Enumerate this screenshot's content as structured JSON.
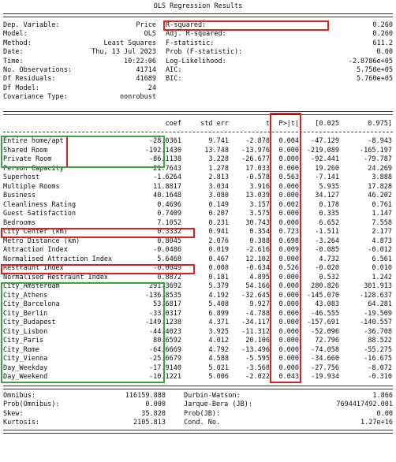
{
  "title": "OLS Regression Results",
  "header_left": [
    {
      "label": "Dep. Variable:",
      "value": "Price"
    },
    {
      "label": "Model:",
      "value": "OLS"
    },
    {
      "label": "Method:",
      "value": "Least Squares"
    },
    {
      "label": "Date:",
      "value": "Thu, 13 Jul 2023"
    },
    {
      "label": "Time:",
      "value": "10:22:06"
    },
    {
      "label": "No. Observations:",
      "value": "41714"
    },
    {
      "label": "Df Residuals:",
      "value": "41689"
    },
    {
      "label": "Df Model:",
      "value": "24"
    },
    {
      "label": "Covariance Type:",
      "value": "nonrobust"
    }
  ],
  "header_right": [
    {
      "label": "R-squared:",
      "value": "0.260"
    },
    {
      "label": "Adj. R-squared:",
      "value": "0.260"
    },
    {
      "label": "F-statistic:",
      "value": "611.2"
    },
    {
      "label": "Prob (F-statistic):",
      "value": "0.00"
    },
    {
      "label": "Log-Likelihood:",
      "value": "-2.8786e+05"
    },
    {
      "label": "AIC:",
      "value": "5.758e+05"
    },
    {
      "label": "BIC:",
      "value": "5.760e+05"
    }
  ],
  "columns": [
    "coef",
    "std err",
    "t",
    "P>|t|",
    "[0.025",
    "0.975]"
  ],
  "rows": [
    {
      "name": "Entire home/apt",
      "coef": "-28.0361",
      "stderr": "9.741",
      "t": "-2.878",
      "p": "0.004",
      "lo": "-47.129",
      "hi": "-8.943"
    },
    {
      "name": "Shared Room",
      "coef": "-192.1430",
      "stderr": "13.748",
      "t": "-13.976",
      "p": "0.000",
      "lo": "-219.089",
      "hi": "-165.197"
    },
    {
      "name": "Private Room",
      "coef": "-86.1138",
      "stderr": "3.228",
      "t": "-26.677",
      "p": "0.000",
      "lo": "-92.441",
      "hi": "-79.787"
    },
    {
      "name": "Person Capacity",
      "coef": "21.7643",
      "stderr": "1.278",
      "t": "17.033",
      "p": "0.000",
      "lo": "19.260",
      "hi": "24.269"
    },
    {
      "name": "Superhost",
      "coef": "-1.6264",
      "stderr": "2.813",
      "t": "-0.578",
      "p": "0.563",
      "lo": "-7.141",
      "hi": "3.888"
    },
    {
      "name": "Multiple Rooms",
      "coef": "11.8817",
      "stderr": "3.034",
      "t": "3.916",
      "p": "0.000",
      "lo": "5.935",
      "hi": "17.828"
    },
    {
      "name": "Business",
      "coef": "40.1648",
      "stderr": "3.080",
      "t": "13.039",
      "p": "0.000",
      "lo": "34.127",
      "hi": "46.202"
    },
    {
      "name": "Cleanliness Rating",
      "coef": "0.4696",
      "stderr": "0.149",
      "t": "3.157",
      "p": "0.002",
      "lo": "0.178",
      "hi": "0.761"
    },
    {
      "name": "Guest Satisfaction",
      "coef": "0.7409",
      "stderr": "0.207",
      "t": "3.575",
      "p": "0.000",
      "lo": "0.335",
      "hi": "1.147"
    },
    {
      "name": "Bedrooms",
      "coef": "7.1052",
      "stderr": "0.231",
      "t": "30.743",
      "p": "0.000",
      "lo": "6.652",
      "hi": "7.558"
    },
    {
      "name": "City Center (km)",
      "coef": "0.3332",
      "stderr": "0.941",
      "t": "0.354",
      "p": "0.723",
      "lo": "-1.511",
      "hi": "2.177"
    },
    {
      "name": "Metro Distance (km)",
      "coef": "0.8045",
      "stderr": "2.076",
      "t": "0.388",
      "p": "0.698",
      "lo": "-3.264",
      "hi": "4.873"
    },
    {
      "name": "Attraction Index",
      "coef": "-0.0486",
      "stderr": "0.019",
      "t": "-2.616",
      "p": "0.009",
      "lo": "-0.085",
      "hi": "-0.012"
    },
    {
      "name": "Normalised Attraction Index",
      "coef": "5.6468",
      "stderr": "0.467",
      "t": "12.102",
      "p": "0.000",
      "lo": "4.732",
      "hi": "6.561"
    },
    {
      "name": "Restraunt Index",
      "coef": "-0.0049",
      "stderr": "0.008",
      "t": "-0.634",
      "p": "0.526",
      "lo": "-0.020",
      "hi": "0.010"
    },
    {
      "name": "Normalised Restraunt Index",
      "coef": "0.8872",
      "stderr": "0.181",
      "t": "4.895",
      "p": "0.000",
      "lo": "0.532",
      "hi": "1.242"
    },
    {
      "name": "City_Amsterdam",
      "coef": "291.3692",
      "stderr": "5.379",
      "t": "54.166",
      "p": "0.000",
      "lo": "280.826",
      "hi": "301.913"
    },
    {
      "name": "City_Athens",
      "coef": "-136.8535",
      "stderr": "4.192",
      "t": "-32.645",
      "p": "0.000",
      "lo": "-145.070",
      "hi": "-128.637"
    },
    {
      "name": "City_Barcelona",
      "coef": "53.6817",
      "stderr": "5.408",
      "t": "9.927",
      "p": "0.000",
      "lo": "43.083",
      "hi": "64.281"
    },
    {
      "name": "City_Berlin",
      "coef": "-33.0317",
      "stderr": "6.899",
      "t": "-4.788",
      "p": "0.000",
      "lo": "-46.555",
      "hi": "-19.509"
    },
    {
      "name": "City_Budapest",
      "coef": "-149.1238",
      "stderr": "4.371",
      "t": "-34.117",
      "p": "0.000",
      "lo": "-157.691",
      "hi": "-140.557"
    },
    {
      "name": "City_Lisbon",
      "coef": "-44.4023",
      "stderr": "3.925",
      "t": "-11.312",
      "p": "0.000",
      "lo": "-52.096",
      "hi": "-36.708"
    },
    {
      "name": "City_Paris",
      "coef": "80.6592",
      "stderr": "4.012",
      "t": "20.106",
      "p": "0.000",
      "lo": "72.796",
      "hi": "88.522"
    },
    {
      "name": "City_Rome",
      "coef": "-64.6669",
      "stderr": "4.792",
      "t": "-13.496",
      "p": "0.000",
      "lo": "-74.058",
      "hi": "-55.275"
    },
    {
      "name": "City_Vienna",
      "coef": "-25.6679",
      "stderr": "4.588",
      "t": "-5.595",
      "p": "0.000",
      "lo": "-34.660",
      "hi": "-16.675"
    },
    {
      "name": "Day_Weekday",
      "coef": "-17.9140",
      "stderr": "5.021",
      "t": "-3.568",
      "p": "0.000",
      "lo": "-27.756",
      "hi": "-8.072"
    },
    {
      "name": "Day_Weekend",
      "coef": "-10.1221",
      "stderr": "5.006",
      "t": "-2.022",
      "p": "0.043",
      "lo": "-19.934",
      "hi": "-0.310"
    }
  ],
  "footer": [
    {
      "l_label": "Omnibus:",
      "l_value": "116159.888",
      "r_label": "Durbin-Watson:",
      "r_value": "1.866"
    },
    {
      "l_label": "Prob(Omnibus):",
      "l_value": "0.000",
      "r_label": "Jarque-Bera (JB):",
      "r_value": "7694417492.001"
    },
    {
      "l_label": "Skew:",
      "l_value": "35.828",
      "r_label": "Prob(JB):",
      "r_value": "0.00"
    },
    {
      "l_label": "Kurtosis:",
      "l_value": "2105.813",
      "r_label": "Cond. No.",
      "r_value": "1.27e+16"
    }
  ],
  "highlight_colors": {
    "red": "#e02020",
    "green": "#3aa53a"
  }
}
